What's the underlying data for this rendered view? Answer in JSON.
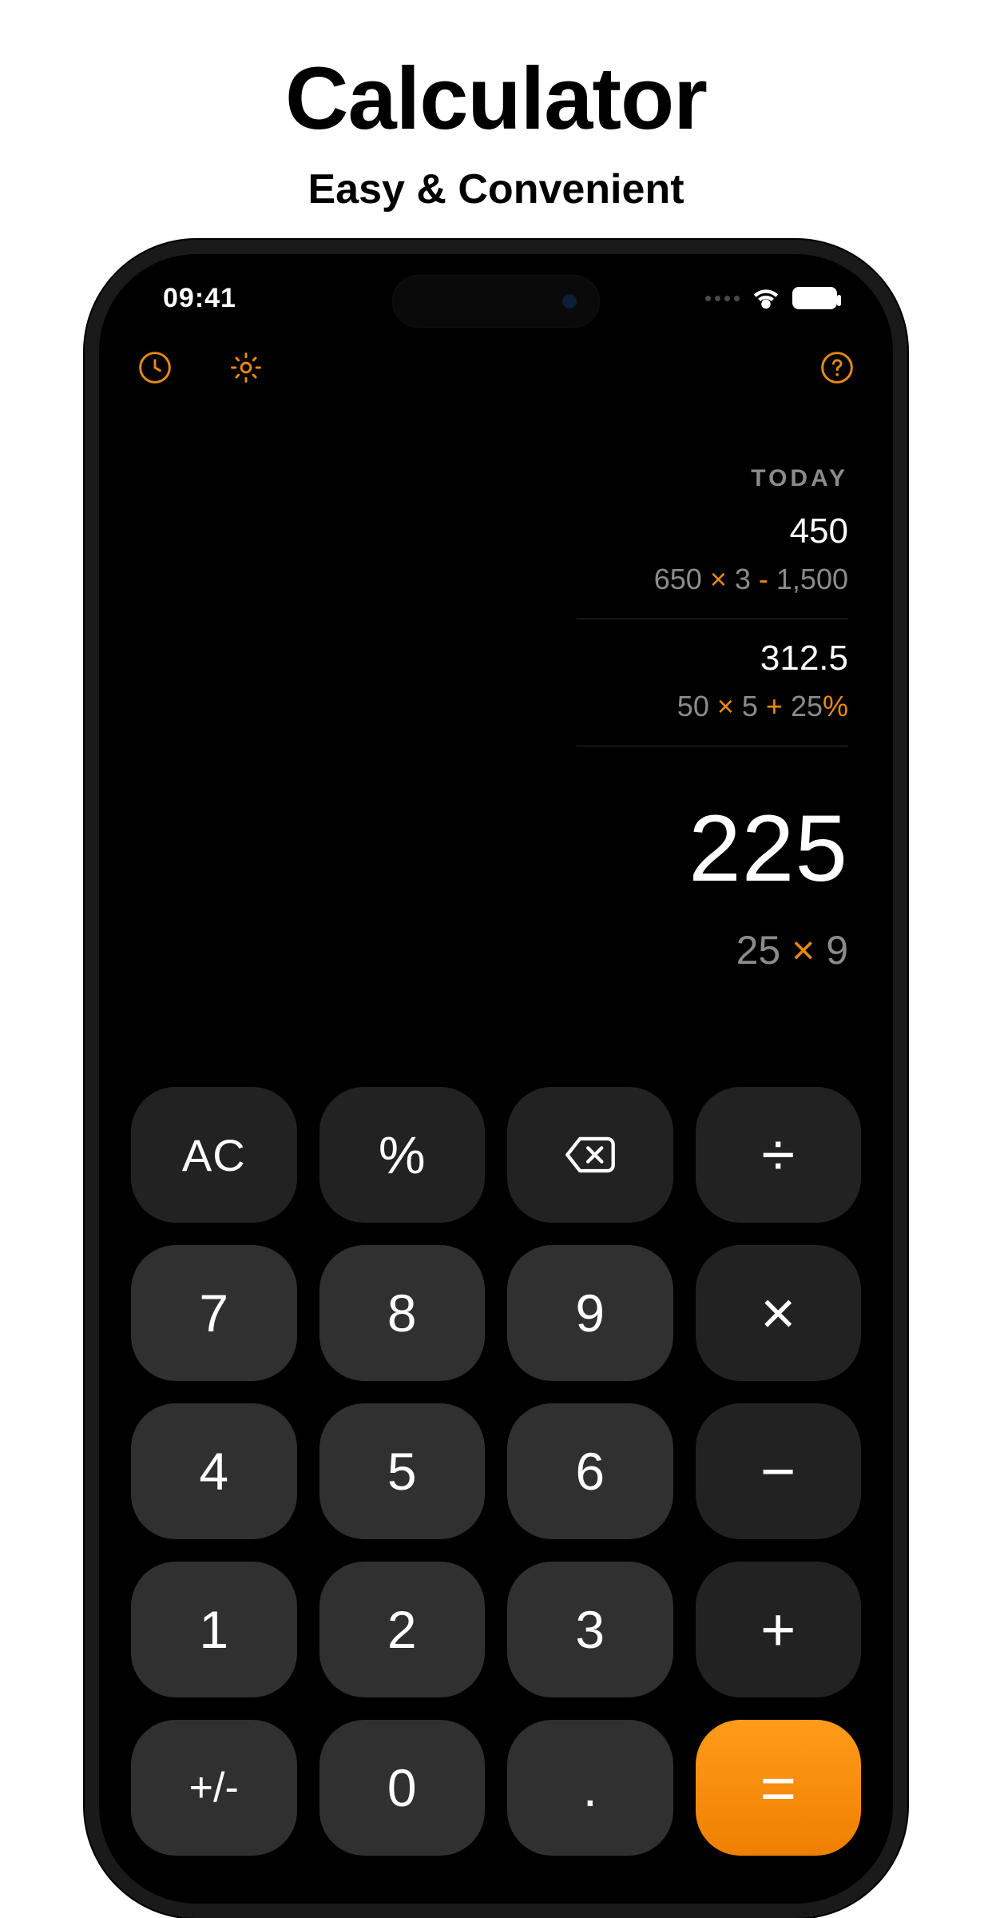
{
  "promo": {
    "title": "Calculator",
    "subtitle": "Easy & Convenient"
  },
  "status": {
    "time": "09:41"
  },
  "colors": {
    "accent_orange": "#e68a12",
    "key_func_bg": "#222222",
    "key_num_bg": "#303030",
    "equals_bg": "#f08700"
  },
  "history": {
    "label": "TODAY",
    "entries": [
      {
        "result": "450",
        "expression": "650 × 3 - 1,500"
      },
      {
        "result": "312.5",
        "expression": "50 × 5 + 25%"
      }
    ]
  },
  "current": {
    "result": "225",
    "expression": "25 × 9"
  },
  "keypad": {
    "r0": {
      "ac": "AC",
      "percent": "%",
      "backspace": "⌫",
      "divide": "÷"
    },
    "r1": {
      "n7": "7",
      "n8": "8",
      "n9": "9",
      "multiply": "×"
    },
    "r2": {
      "n4": "4",
      "n5": "5",
      "n6": "6",
      "minus": "−"
    },
    "r3": {
      "n1": "1",
      "n2": "2",
      "n3": "3",
      "plus": "+"
    },
    "r4": {
      "sign": "+/-",
      "n0": "0",
      "dot": ".",
      "equals": "="
    }
  }
}
